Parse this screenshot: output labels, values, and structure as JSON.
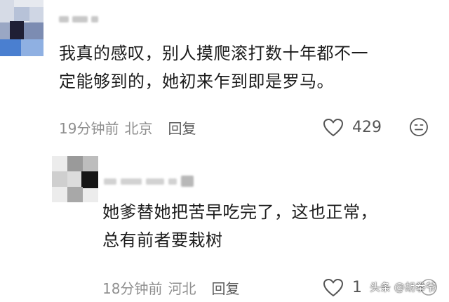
{
  "comments": [
    {
      "text_line1": "我真的感叹，别人摸爬滚打数十年都不一",
      "text_line2": "定能够到的，她初来乍到即是罗马。",
      "time": "19分钟前",
      "location": "北京",
      "reply_label": "回复",
      "like_count": "429",
      "like_icon": "heart-outline-icon",
      "extra_icon": "emoji-face-icon"
    },
    {
      "text_line1": "她爹替她把苦早吃完了，这也正常，",
      "text_line2": "总有前者要栽树",
      "time": "18分钟前",
      "location": "河北",
      "reply_label": "回复",
      "like_count": "1",
      "like_icon": "heart-outline-icon"
    }
  ],
  "watermark": "头条 @胡拳爷",
  "colors": {
    "text": "#1c1c1c",
    "meta": "#8f8f8f",
    "icon": "#555555"
  }
}
